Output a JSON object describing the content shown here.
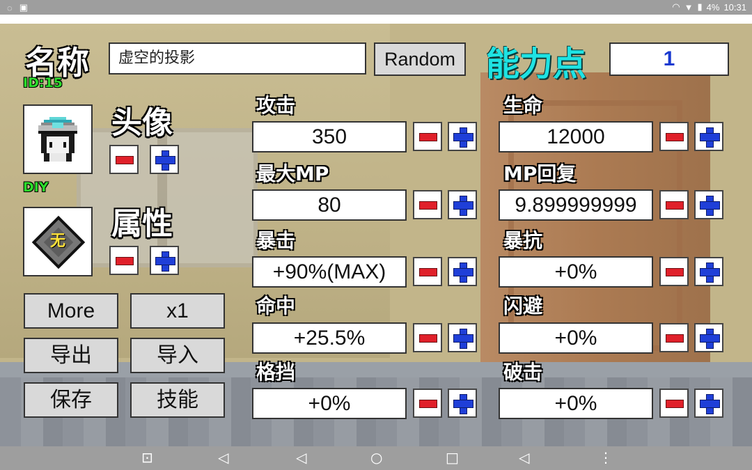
{
  "status_bar": {
    "battery": "4%",
    "time": "10:31"
  },
  "header": {
    "name_label": "名称",
    "id_label": "ID:15",
    "name_value": "虚空的投影",
    "random_label": "Random",
    "ability_points_label": "能力点",
    "ability_points_value": "1"
  },
  "left_panel": {
    "avatar_label": "头像",
    "diy_label": "DIY",
    "attribute_label": "属性",
    "attribute_char": "无",
    "buttons": {
      "more": "More",
      "multiplier": "x1",
      "export": "导出",
      "import": "导入",
      "save": "保存",
      "skills": "技能"
    }
  },
  "stats": [
    {
      "label": "攻击",
      "value": "350"
    },
    {
      "label": "生命",
      "value": "12000"
    },
    {
      "label": "最大MP",
      "value": "80"
    },
    {
      "label": "MP回复",
      "value": "9.899999999"
    },
    {
      "label": "暴击",
      "value": "+90%(MAX)"
    },
    {
      "label": "暴抗",
      "value": "+0%"
    },
    {
      "label": "命中",
      "value": "+25.5%"
    },
    {
      "label": "闪避",
      "value": "+0%"
    },
    {
      "label": "格挡",
      "value": "+0%"
    },
    {
      "label": "破击",
      "value": "+0%"
    }
  ],
  "colors": {
    "id_green": "#2bdc2b",
    "ability_cyan": "#1ee3e3",
    "points_blue": "#1a3ad0",
    "minus_red": "#e0202a",
    "plus_blue": "#1f3fd8"
  }
}
